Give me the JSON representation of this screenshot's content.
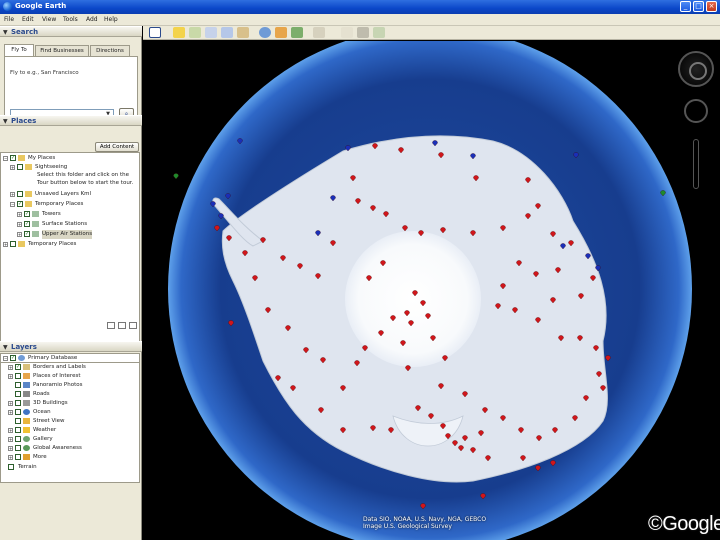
{
  "window": {
    "title": "Google Earth"
  },
  "menu": [
    "File",
    "Edit",
    "View",
    "Tools",
    "Add",
    "Help"
  ],
  "search": {
    "header": "Search",
    "tabs": [
      "Fly To",
      "Find Businesses",
      "Directions"
    ],
    "hint": "Fly to e.g., San Francisco",
    "input_value": ""
  },
  "places": {
    "header": "Places",
    "add_content_label": "Add Content",
    "items": [
      {
        "label": "My Places",
        "indent": 0
      },
      {
        "label": "Sightseeing",
        "indent": 2
      },
      {
        "label": "Select this folder and click on the",
        "indent": 3
      },
      {
        "label": "Tour button below to start the tour.",
        "indent": 3
      },
      {
        "label": "Unsaved Layers Kml",
        "indent": 2
      },
      {
        "label": "Temporary Places",
        "indent": 1
      },
      {
        "label": "Towers",
        "indent": 2
      },
      {
        "label": "Surface Stations",
        "indent": 2
      },
      {
        "label": "Upper Air Stations",
        "indent": 2
      },
      {
        "label": "Temporary Places",
        "indent": 0
      }
    ]
  },
  "layers": {
    "header": "Layers",
    "items": [
      "Primary Database",
      "Borders and Labels",
      "Places of Interest",
      "Panoramio Photos",
      "Roads",
      "3D Buildings",
      "Ocean",
      "Street View",
      "Weather",
      "Gallery",
      "Global Awareness",
      "More",
      "Terrain"
    ]
  },
  "map": {
    "attribution": "Data SIO, NOAA, U.S. Navy, NGA, GEBCO\nImage U.S. Geological Survey",
    "logo": "Google"
  },
  "colors": {
    "marker_red": "#d0161b",
    "marker_blue": "#1a2fb8",
    "ice": "#dfe5ef",
    "ocean": "#14307a"
  }
}
